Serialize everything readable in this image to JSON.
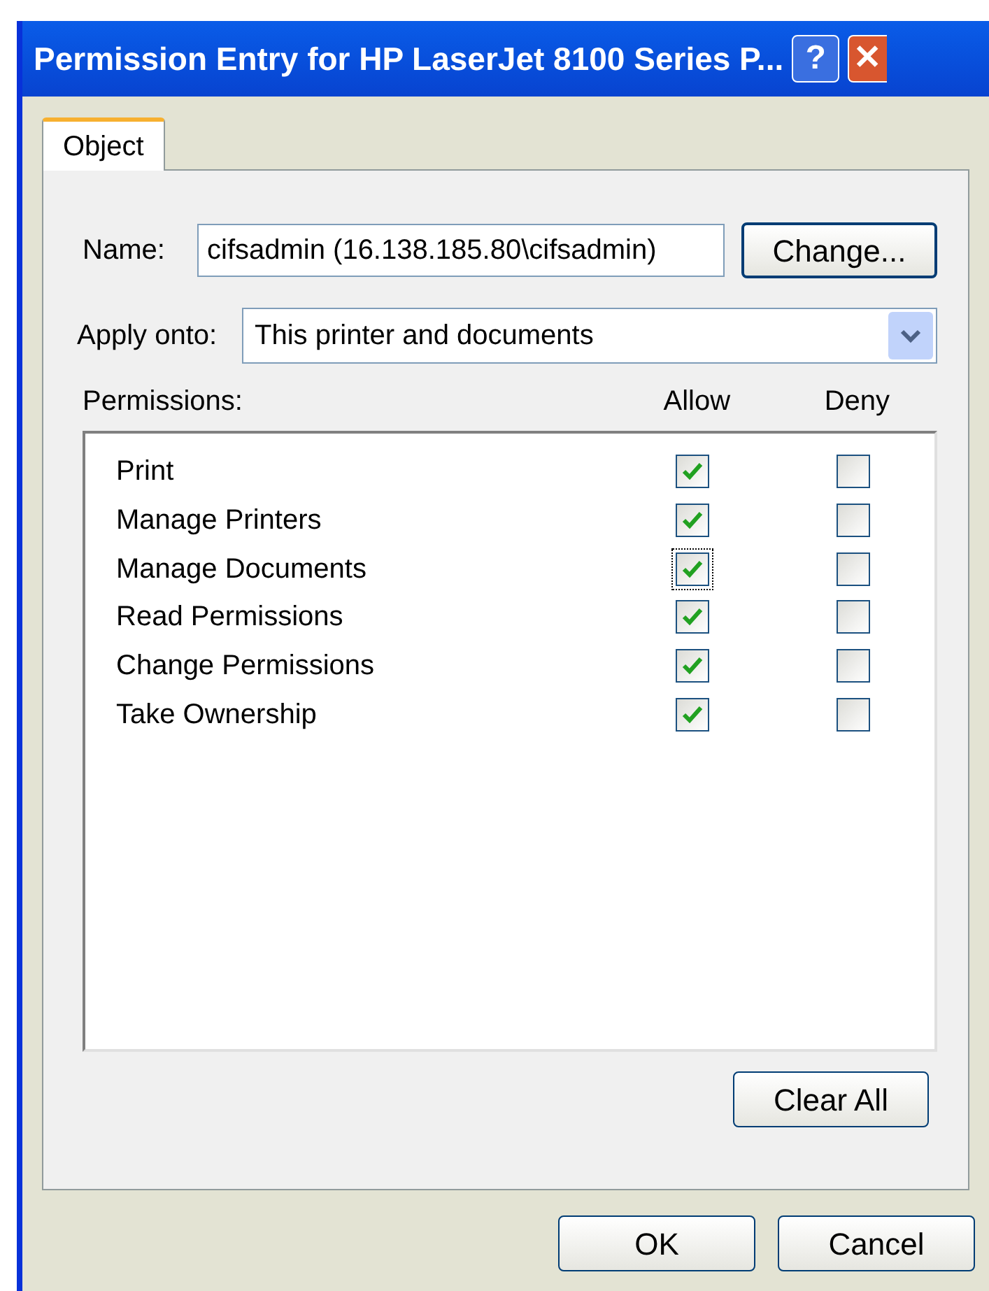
{
  "window": {
    "title": "Permission Entry for HP LaserJet 8100 Series P...",
    "help_button": "?",
    "close_button": "✕"
  },
  "tabs": [
    {
      "label": "Object",
      "selected": true
    }
  ],
  "name_field": {
    "label": "Name:",
    "value": "cifsadmin (16.138.185.80\\cifsadmin)",
    "button": "Change..."
  },
  "apply_onto": {
    "label": "Apply onto:",
    "value": "This printer and documents"
  },
  "permissions": {
    "label": "Permissions:",
    "columns": [
      "Allow",
      "Deny"
    ],
    "rows": [
      {
        "name": "Print",
        "allow": true,
        "deny": false,
        "focused": false
      },
      {
        "name": "Manage Printers",
        "allow": true,
        "deny": false,
        "focused": false
      },
      {
        "name": "Manage Documents",
        "allow": true,
        "deny": false,
        "focused": true
      },
      {
        "name": "Read Permissions",
        "allow": true,
        "deny": false,
        "focused": false
      },
      {
        "name": "Change Permissions",
        "allow": true,
        "deny": false,
        "focused": false
      },
      {
        "name": "Take Ownership",
        "allow": true,
        "deny": false,
        "focused": false
      }
    ]
  },
  "clear_button": "Clear All",
  "buttons": [
    "OK",
    "Cancel"
  ]
}
